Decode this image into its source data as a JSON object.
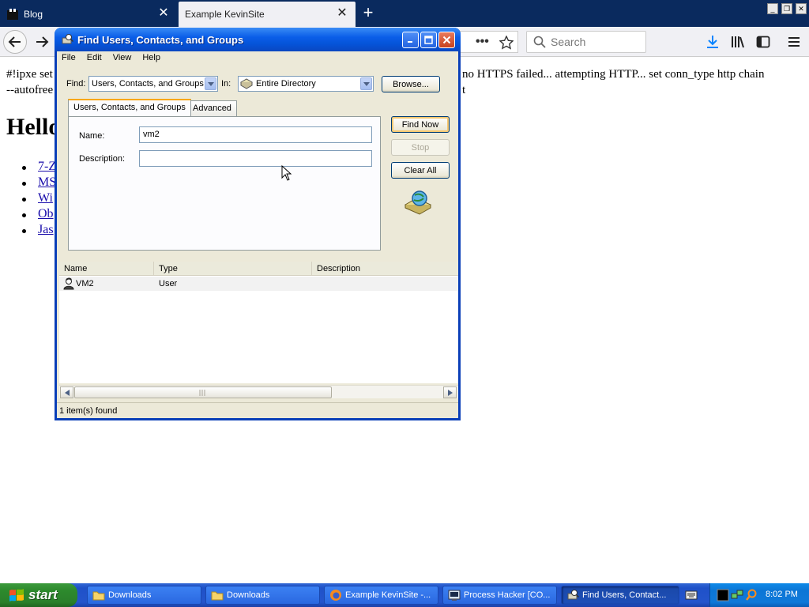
{
  "browser": {
    "tabs": [
      {
        "label": "Blog",
        "active": false
      },
      {
        "label": "Example KevinSite",
        "active": true
      }
    ],
    "search_placeholder": "Search",
    "icons": [
      "back-arrow-icon",
      "forward-arrow-icon",
      "more-dots-icon",
      "bookmark-star-icon",
      "search-icon",
      "download-icon",
      "library-icon",
      "sidebar-icon",
      "menu-icon"
    ]
  },
  "page": {
    "text_line1_left": "#!ipxe set",
    "text_line1_right": "no HTTPS failed... attempting HTTP... set conn_type http chain",
    "text_line2_left": "--autofree",
    "text_line2_right": "t",
    "heading": "Hello",
    "links": [
      "7-Z",
      "MS",
      "Wi",
      "Ob",
      "Jas"
    ]
  },
  "dialog": {
    "title": "Find Users, Contacts, and Groups",
    "menu": [
      "File",
      "Edit",
      "View",
      "Help"
    ],
    "find_label": "Find:",
    "find_value": "Users, Contacts, and Groups",
    "in_label": "In:",
    "in_value": "Entire Directory",
    "browse_button": "Browse...",
    "tabs": [
      "Users, Contacts, and Groups",
      "Advanced"
    ],
    "name_label": "Name:",
    "name_value": "vm2",
    "description_label": "Description:",
    "description_value": "",
    "find_now_button": "Find Now",
    "stop_button": "Stop",
    "clear_all_button": "Clear All",
    "results": {
      "columns": [
        "Name",
        "Type",
        "Description"
      ],
      "rows": [
        {
          "name": "VM2",
          "type": "User",
          "description": ""
        }
      ]
    },
    "status": "1 item(s) found"
  },
  "taskbar": {
    "start_label": "start",
    "tasks": [
      {
        "label": "Downloads",
        "icon": "folder-icon",
        "active": false
      },
      {
        "label": "Downloads",
        "icon": "folder-icon",
        "active": false
      },
      {
        "label": "Example KevinSite -...",
        "icon": "firefox-icon",
        "active": false
      },
      {
        "label": "Process Hacker [CO...",
        "icon": "process-hacker-icon",
        "active": false
      },
      {
        "label": "Find Users, Contact...",
        "icon": "find-users-icon",
        "active": true
      }
    ],
    "clock": "8:02 PM"
  },
  "colors": {
    "xp_taskbar": "#2455cc",
    "xp_start_green": "#2d8a2d",
    "xp_titlebar": "#0553d8",
    "xp_dialog_bg": "#ece9d8",
    "firefox_tabbar": "#0a2a5e",
    "link": "#1a0dab"
  }
}
